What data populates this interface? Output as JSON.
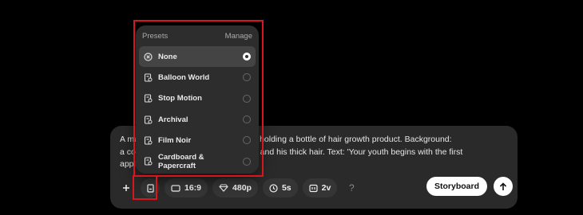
{
  "prompt": {
    "line1": "A man looks in the mirror and smiles, holding a bottle of hair growth product. Background:",
    "line2": "a cozy bathroom. Focus on the bottle and his thick hair. Text: 'Your youth begins with the first",
    "line3": "appli"
  },
  "toolbar": {
    "aspect": "16:9",
    "resolution": "480p",
    "duration": "5s",
    "variants": "2v",
    "help": "?"
  },
  "actions": {
    "storyboard": "Storyboard"
  },
  "presets_menu": {
    "title": "Presets",
    "manage": "Manage",
    "items": [
      {
        "label": "None",
        "selected": true
      },
      {
        "label": "Balloon World",
        "selected": false
      },
      {
        "label": "Stop Motion",
        "selected": false
      },
      {
        "label": "Archival",
        "selected": false
      },
      {
        "label": "Film Noir",
        "selected": false
      },
      {
        "label": "Cardboard & Papercraft",
        "selected": false
      }
    ]
  },
  "colors": {
    "highlight": "#d8161e",
    "panel": "#2d2d2d",
    "composer": "#2a2a2a"
  },
  "icons": [
    "plus-icon",
    "presets-icon",
    "aspect-icon",
    "gem-icon",
    "clock-icon",
    "variants-icon",
    "arrow-up-icon",
    "x-circle-icon",
    "preset-doc-icon"
  ]
}
